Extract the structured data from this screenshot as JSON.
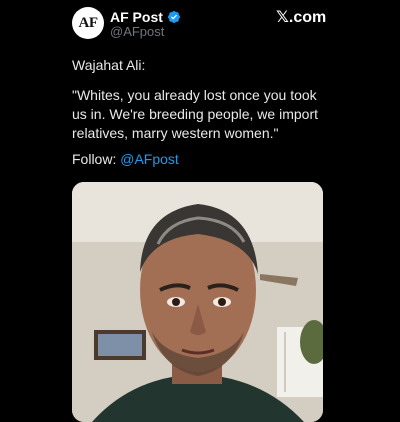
{
  "post": {
    "author_name": "AF Post",
    "handle": "@AFpost",
    "avatar_text": "AF",
    "brand": "𝕏.com",
    "line1": "Wajahat Ali:",
    "quote": "\"Whites, you already lost once you took us in. We're breeding people, we import relatives, marry western women.\"",
    "follow_label": "Follow: ",
    "follow_handle": "@AFpost"
  },
  "colors": {
    "background": "#000000",
    "text": "#e7e9ea",
    "muted": "#71767b",
    "link": "#1d9bf0",
    "verified": "#1d9bf0"
  },
  "icons": {
    "verified": "verified-badge-icon"
  }
}
